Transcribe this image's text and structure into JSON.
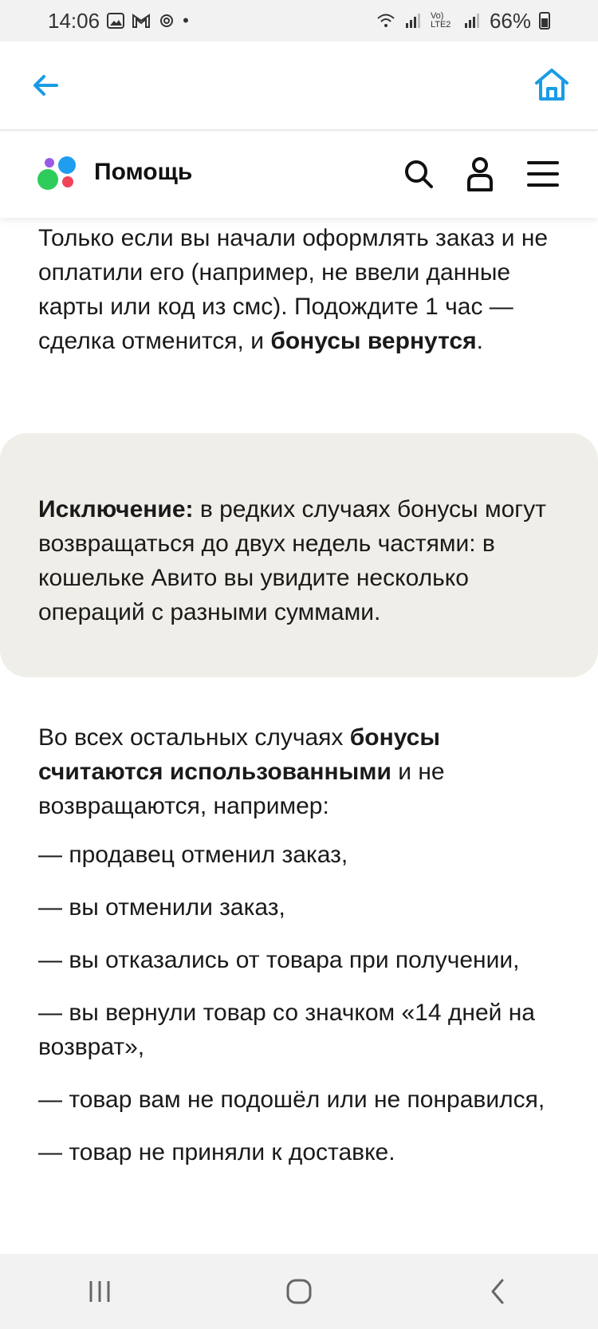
{
  "status_bar": {
    "time": "14:06",
    "battery": "66%",
    "network_label": "Vo) LTE2"
  },
  "top_bar": {
    "back_icon": "arrow-left-icon",
    "home_icon": "home-icon",
    "accent_color": "#1a9be6"
  },
  "header": {
    "title": "Помощь",
    "icons": [
      "search-icon",
      "profile-icon",
      "menu-icon"
    ]
  },
  "article": {
    "p1_a": "Только если вы начали оформлять заказ и не оплатили его (например, не ввели данные карты или код из смс). Подождите 1 час — сделка отменится, и ",
    "p1_bold": "бонусы вернутся",
    "p1_end": ".",
    "exception_bold": "Исключение:",
    "exception_text": " в редких случаях бонусы могут возвращаться до двух недель частями: в кошельке Авито вы увидите несколько операций с разными суммами.",
    "p2_a": "Во всех остальных случаях ",
    "p2_bold": "бонусы считаются использованными",
    "p2_end": " и не возвращаются, например:",
    "list": [
      "— продавец отменил заказ,",
      "— вы отменили заказ,",
      "— вы отказались от товара при получении,",
      "— вы вернули товар со значком «14 дней на возврат»,",
      "— товар вам не подошёл или не понравился,",
      "— товар не приняли к доставке."
    ]
  },
  "nav_bar": {
    "icons": [
      "recent-apps-icon",
      "home-nav-icon",
      "back-nav-icon"
    ]
  }
}
